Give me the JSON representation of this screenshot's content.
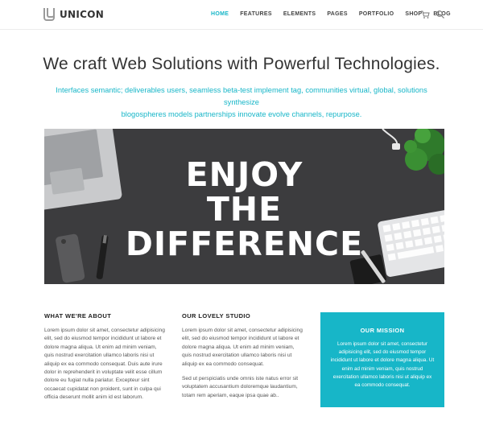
{
  "brand": {
    "name": "UNICON"
  },
  "nav": {
    "items": [
      {
        "label": "HOME",
        "active": true
      },
      {
        "label": "FEATURES",
        "active": false
      },
      {
        "label": "ELEMENTS",
        "active": false
      },
      {
        "label": "PAGES",
        "active": false
      },
      {
        "label": "PORTFOLIO",
        "active": false
      },
      {
        "label": "SHOP",
        "active": false
      },
      {
        "label": "BLOG",
        "active": false
      }
    ],
    "icons": [
      "cart-icon",
      "search-icon"
    ]
  },
  "colors": {
    "accent": "#17b6c8",
    "hero_bg": "#3c3c3e",
    "text_dark": "#333333"
  },
  "hero_section": {
    "headline": "We craft Web Solutions with Powerful Technologies.",
    "intro_line1": "Interfaces semantic; deliverables users, seamless beta-test implement tag, communities virtual, global, solutions synthesize",
    "intro_line2": "blogospheres models partnerships innovate evolve channels, repurpose."
  },
  "banner": {
    "line1": "ENJOY",
    "line2": "THE",
    "line3": "DIFFERENCE"
  },
  "columns": {
    "about": {
      "title": "WHAT WE'RE ABOUT",
      "text": "Lorem ipsum dolor sit amet, consectetur adipisicing elit, sed do eiusmod tempor incididunt ut labore et dolore magna aliqua. Ut enim ad minim veniam, quis nostrud exercitation ullamco laboris nisi ut aliquip ex ea commodo consequat. Duis aute irure dolor in reprehenderit in voluptate velit esse cillum dolore eu fugiat nulla pariatur. Excepteur sint occaecat cupidatat non proident, sunt in culpa qui officia deserunt mollit anim id est laborum."
    },
    "studio": {
      "title": "OUR LOVELY STUDIO",
      "text1": "Lorem ipsum dolor sit amet, consectetur adipisicing elit, sed do eiusmod tempor incididunt ut labore et dolore magna aliqua. Ut enim ad minim veniam, quis nostrud exercitation ullamco laboris nisi ut aliquip ex ea commodo consequat.",
      "text2": "Sed ut perspiciatis unde omnis iste natus error sit voluptatem accusantium doloremque laudantium, totam rem aperiam, eaque ipsa quae ab.."
    },
    "mission": {
      "title": "OUR MISSION",
      "text": "Lorem ipsum dolor sit amet, consectetur adipisicing elit, sed do eiusmod tempor incididunt ut labore et dolore magna aliqua. Ut enim ad minim veniam, quis nostrud exercitation ullamco laboris nisi ut aliquip ex ea commodo consequat."
    }
  }
}
